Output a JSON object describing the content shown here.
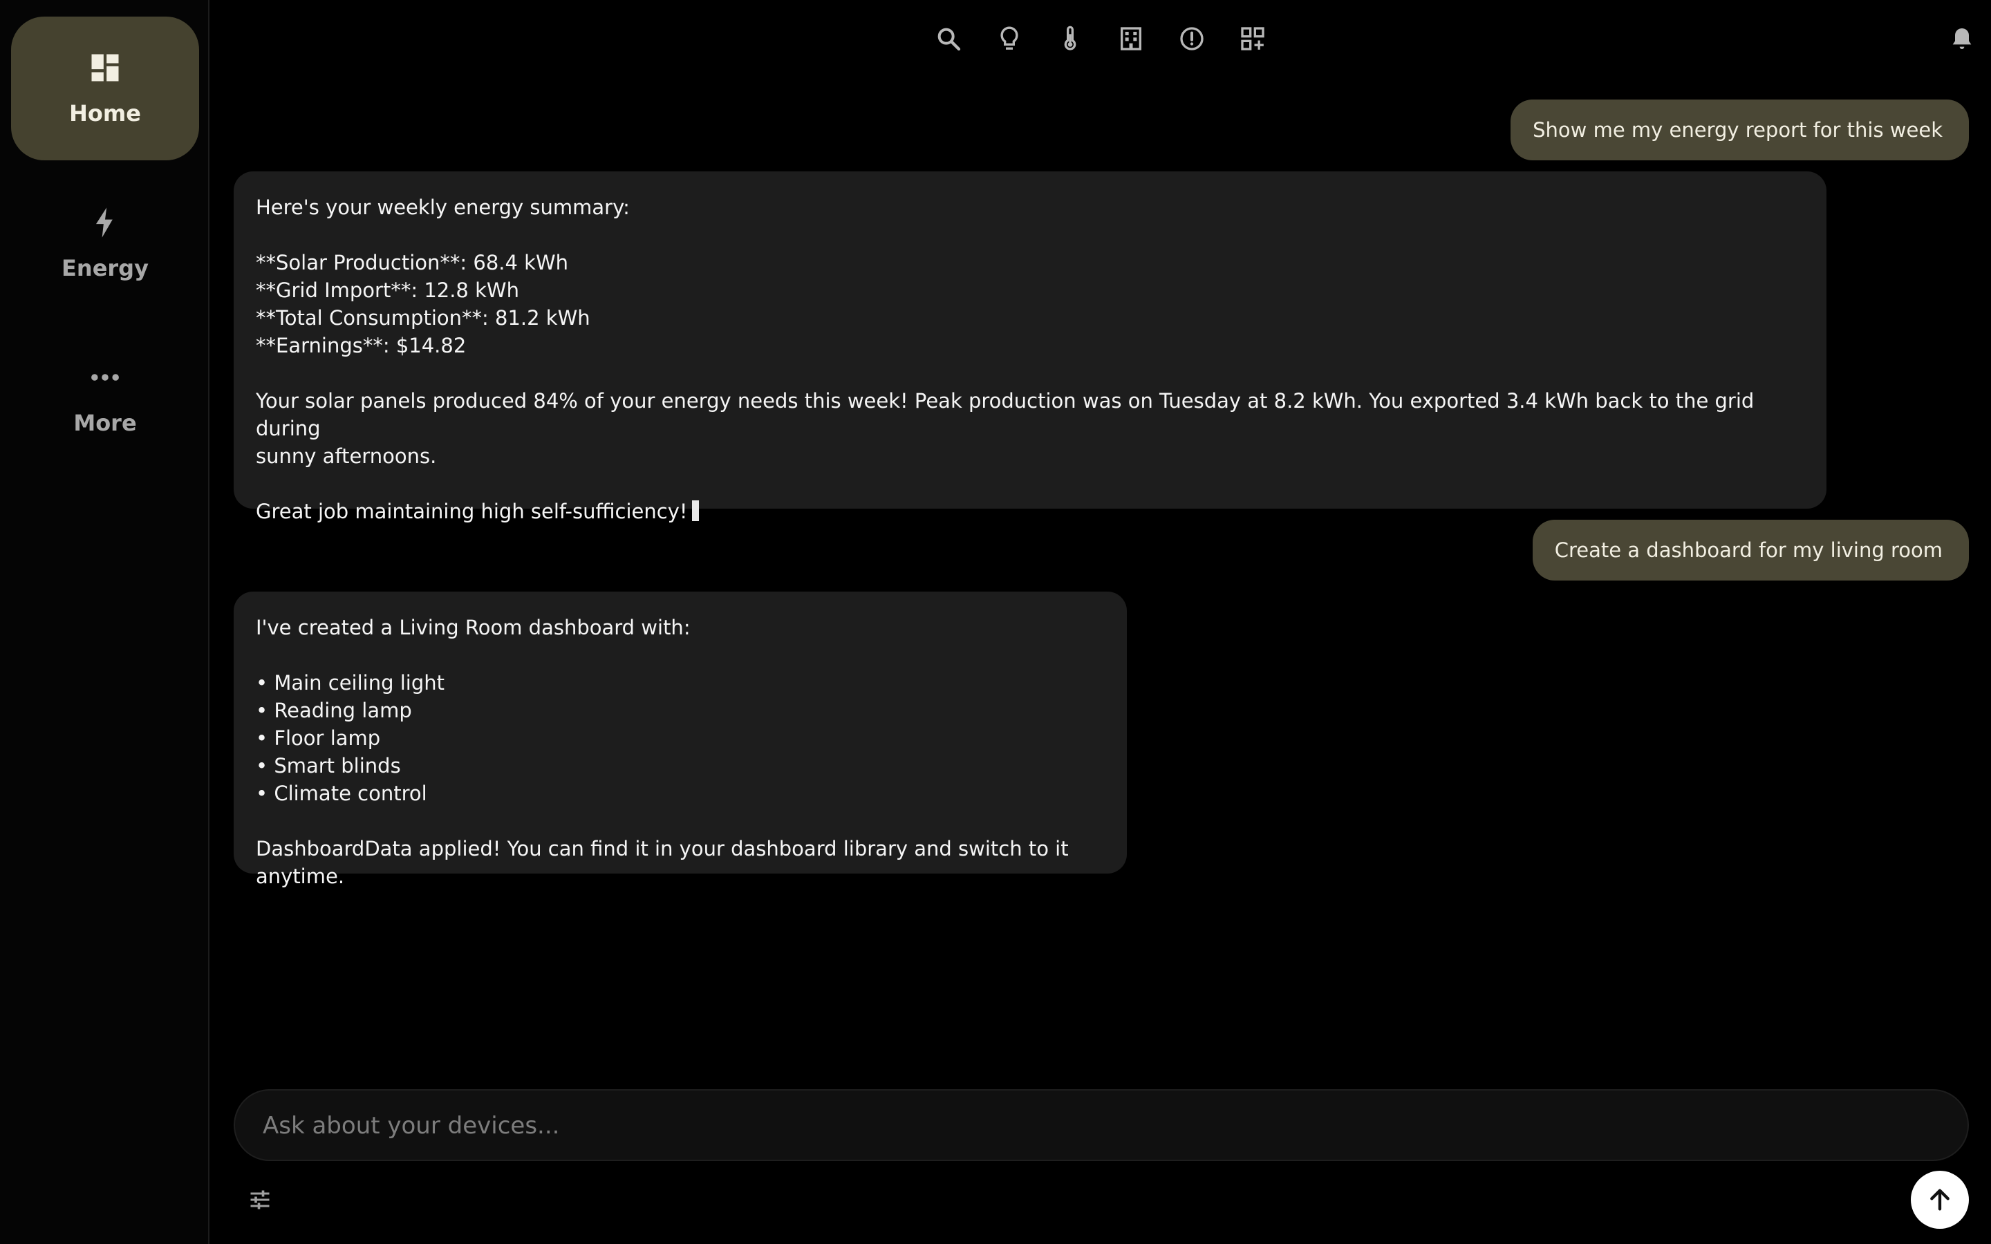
{
  "sidebar": {
    "items": [
      {
        "label": "Home",
        "icon": "dashboard-icon",
        "active": true
      },
      {
        "label": "Energy",
        "icon": "lightning-icon",
        "active": false
      },
      {
        "label": "More",
        "icon": "more-dots-icon",
        "active": false
      }
    ]
  },
  "toolbar": {
    "icons": [
      "search-icon",
      "lightbulb-icon",
      "thermometer-icon",
      "building-icon",
      "alert-icon",
      "add-widget-icon",
      "bell-icon"
    ]
  },
  "chat": {
    "messages": [
      {
        "role": "user",
        "text": "Show me my energy report for this week"
      },
      {
        "role": "assistant",
        "text": "Here's your weekly energy summary:\n\n**Solar Production**: 68.4 kWh\n**Grid Import**: 12.8 kWh\n**Total Consumption**: 81.2 kWh\n**Earnings**: $14.82\n\nYour solar panels produced 84% of your energy needs this week! Peak production was on Tuesday at 8.2 kWh. You exported 3.4 kWh back to the grid during\nsunny afternoons.\n\nGreat job maintaining high self-sufficiency!"
      },
      {
        "role": "user",
        "text": "Create a dashboard for my living room"
      },
      {
        "role": "assistant",
        "text": "I've created a Living Room dashboard with:\n\n• Main ceiling light\n• Reading lamp\n• Floor lamp\n• Smart blinds\n• Climate control\n\nDashboardData applied! You can find it in your dashboard library and switch to it anytime."
      }
    ]
  },
  "input": {
    "placeholder": "Ask about your devices...",
    "value": ""
  },
  "colors": {
    "accent": "#45422f",
    "user_bubble": "#4a4735",
    "assistant_bubble": "#1d1d1d",
    "background": "#000000"
  }
}
